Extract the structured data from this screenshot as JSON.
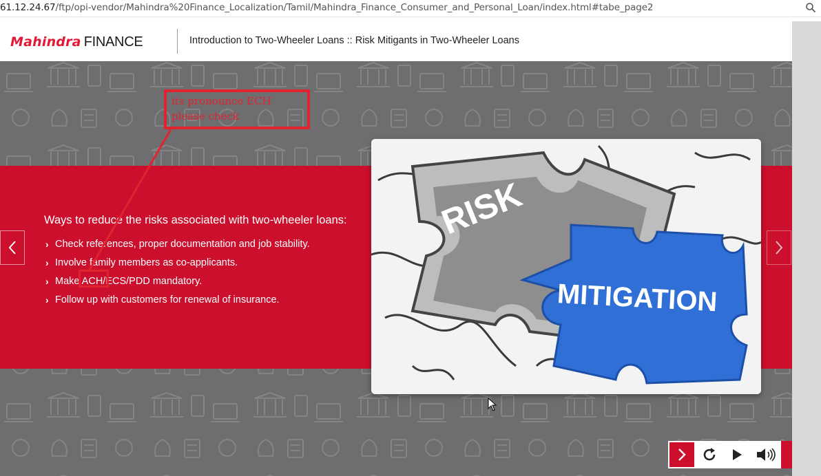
{
  "browser": {
    "url_host": "61.12.24.67",
    "url_path": "/ftp/opi-vendor/Mahindra%20Finance_Localization/Tamil/Mahindra_Finance_Consumer_and_Personal_Loan/index.html#tabe_page2",
    "zoom_icon": "magnifier-icon"
  },
  "header": {
    "logo_brand": "Mahindra",
    "logo_product": "FINANCE",
    "title": "Introduction to Two-Wheeler Loans :: Risk Mitigants in Two-Wheeler Loans"
  },
  "slide": {
    "heading": "Ways to reduce the risks associated with two-wheeler loans:",
    "bullets": [
      "Check references, proper documentation and job stability.",
      "Involve family members as co-applicants.",
      "Make ACH/ECS/PDD mandatory.",
      "Follow up with customers for renewal of insurance."
    ],
    "image_words": {
      "risk": "RISK",
      "mitigation": "MITIGATION"
    }
  },
  "annotation": {
    "line1": "its pronounce ECH",
    "line2": "please check"
  },
  "controls": {
    "next_icon": "chevron-right-icon",
    "replay_icon": "replay-icon",
    "play_icon": "play-icon",
    "audio_icon": "speaker-icon"
  },
  "colors": {
    "brand_red": "#cb0f2c",
    "annotation_red": "#e0242f",
    "stage_grey": "#6e6e70",
    "puzzle_blue": "#2f6fd6"
  }
}
